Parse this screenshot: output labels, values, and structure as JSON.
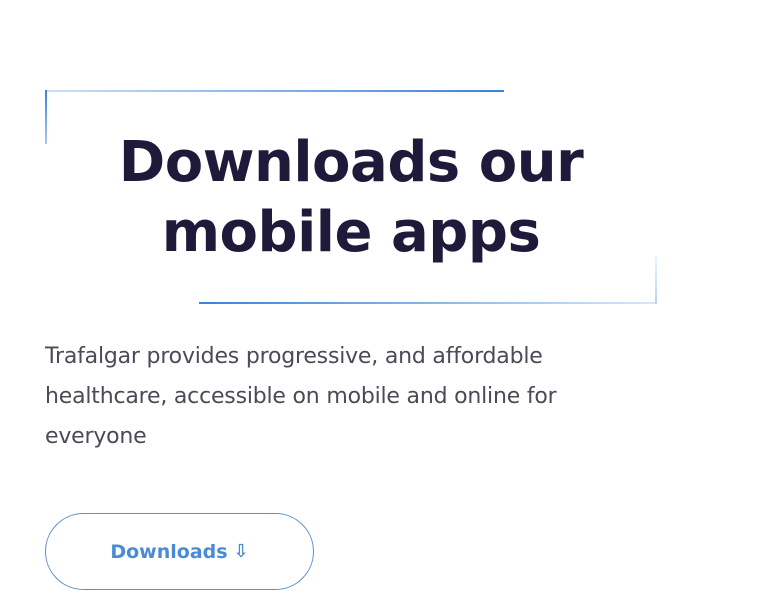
{
  "hero": {
    "headline_line1": "Downloads our",
    "headline_line2": "mobile apps",
    "description": "Trafalgar provides progressive, and affordable healthcare, accessible on mobile and online for everyone",
    "button_label": "Downloads",
    "button_icon": "⇩",
    "button_icon_name": "download-arrow-icon"
  },
  "colors": {
    "heading": "#1f1a3a",
    "body_text": "#4b4b57",
    "accent": "#3b82d9",
    "button_text": "#4a8bd6",
    "background": "#ffffff"
  }
}
